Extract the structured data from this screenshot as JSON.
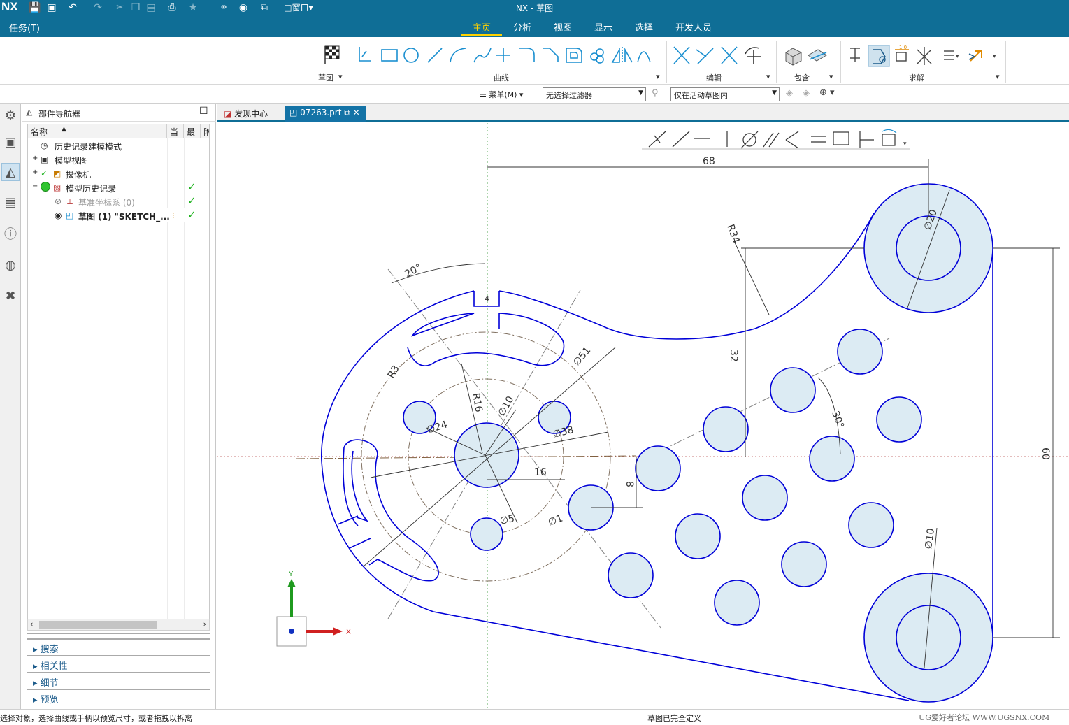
{
  "app": {
    "logo": "NX",
    "title": "NX - 草图"
  },
  "quick_access": {
    "window_menu": "窗口"
  },
  "menu": {
    "task": "任务(T)"
  },
  "tabs": [
    {
      "label": "主页",
      "active": true
    },
    {
      "label": "分析"
    },
    {
      "label": "视图"
    },
    {
      "label": "显示"
    },
    {
      "label": "选择"
    },
    {
      "label": "开发人员"
    }
  ],
  "ribbon": {
    "groups": [
      "草图",
      "曲线",
      "编辑",
      "包含",
      "求解"
    ]
  },
  "filter_bar": {
    "menu_label": "菜单(M)",
    "type_filter": "无选择过滤器",
    "scope_filter": "仅在活动草图内"
  },
  "navigator": {
    "title": "部件导航器",
    "columns": [
      "名称",
      "当",
      "最",
      "附"
    ],
    "rows": [
      {
        "label": "历史记录建模模式"
      },
      {
        "label": "模型视图"
      },
      {
        "label": "摄像机"
      },
      {
        "label": "模型历史记录"
      },
      {
        "label": "基准坐标系 (0)"
      },
      {
        "label": "草图 (1) \"SKETCH_..."
      }
    ],
    "sections": [
      "搜索",
      "相关性",
      "细节",
      "预览"
    ]
  },
  "doc_tabs": [
    {
      "label": "发现中心"
    },
    {
      "label": "07263.prt"
    }
  ],
  "sketch": {
    "dims": {
      "d68": "68",
      "d60": "60",
      "d32": "32",
      "d16": "16",
      "d8": "8",
      "d4": "4",
      "r34": "R34",
      "r16": "R16",
      "r3": "R3",
      "ang20": "20°",
      "ang30": "30°",
      "dia51": "∅51",
      "dia38": "∅38",
      "dia24": "∅24",
      "dia10a": "∅10",
      "dia10b": "∅10",
      "dia20": "∅20",
      "dia5": "∅5",
      "dia1": "∅1"
    },
    "axis": {
      "y": "Y",
      "x": "X"
    }
  },
  "status": {
    "left": "选择对象，选择曲线或手柄以预览尺寸，或者拖拽以拆离",
    "center": "草图已完全定义",
    "right": "UG爱好者论坛 WWW.UGSNX.COM"
  },
  "colors": {
    "brand": "#0f6e96",
    "active_tab": "#ffd200",
    "sketch_curve": "#0000d8",
    "hole_fill": "#dcebf3"
  }
}
